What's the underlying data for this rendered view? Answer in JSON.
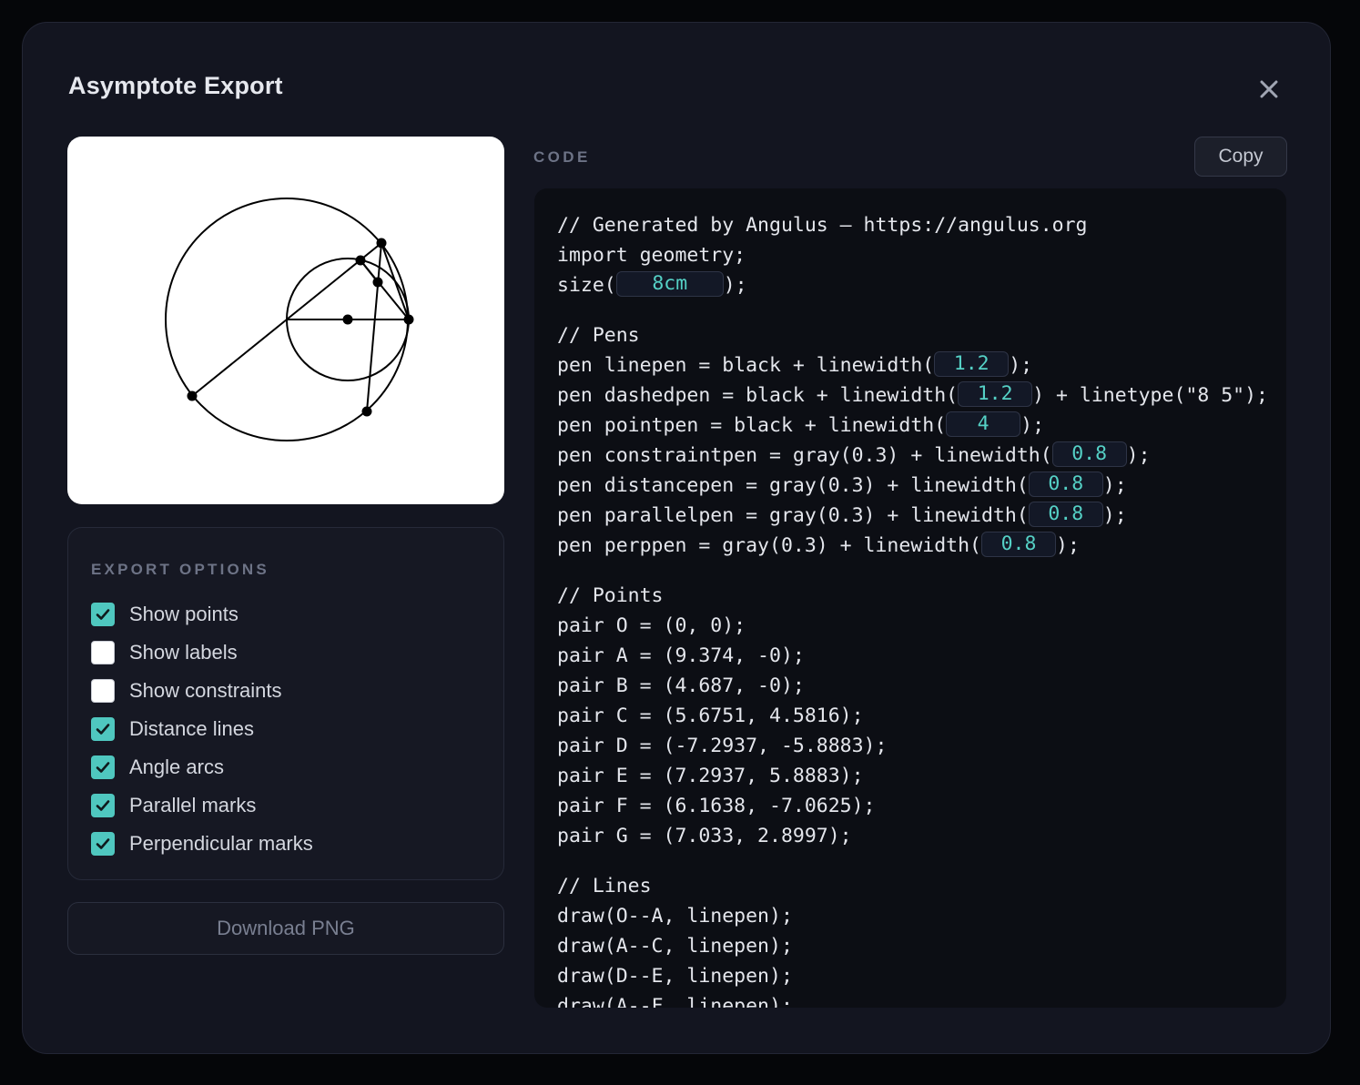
{
  "dialog": {
    "title": "Asymptote Export",
    "close_icon": "close-icon"
  },
  "export_options": {
    "heading": "EXPORT OPTIONS",
    "items": [
      {
        "label": "Show points",
        "checked": true
      },
      {
        "label": "Show labels",
        "checked": false
      },
      {
        "label": "Show constraints",
        "checked": false
      },
      {
        "label": "Distance lines",
        "checked": true
      },
      {
        "label": "Angle arcs",
        "checked": true
      },
      {
        "label": "Parallel marks",
        "checked": true
      },
      {
        "label": "Perpendicular marks",
        "checked": true
      }
    ]
  },
  "download_label": "Download PNG",
  "code_panel": {
    "label": "CODE",
    "copy_label": "Copy",
    "header_lines": [
      "// Generated by Angulus — https://angulus.org",
      "import geometry;"
    ],
    "size": {
      "prefix": "size(",
      "value": "8cm",
      "suffix": ");"
    },
    "pens_comment": "// Pens",
    "pens": [
      {
        "prefix": "pen linepen = black + linewidth(",
        "value": "1.2",
        "suffix": ");"
      },
      {
        "prefix": "pen dashedpen = black + linewidth(",
        "value": "1.2",
        "suffix": ") + linetype(\"8 5\");"
      },
      {
        "prefix": "pen pointpen = black + linewidth(",
        "value": "4",
        "suffix": ");"
      },
      {
        "prefix": "pen constraintpen = gray(0.3) + linewidth(",
        "value": "0.8",
        "suffix": ");"
      },
      {
        "prefix": "pen distancepen = gray(0.3) + linewidth(",
        "value": "0.8",
        "suffix": ");"
      },
      {
        "prefix": "pen parallelpen = gray(0.3) + linewidth(",
        "value": "0.8",
        "suffix": ");"
      },
      {
        "prefix": "pen perppen = gray(0.3) + linewidth(",
        "value": "0.8",
        "suffix": ");"
      }
    ],
    "points_comment": "// Points",
    "points": [
      "pair O = (0, 0);",
      "pair A = (9.374, -0);",
      "pair B = (4.687, -0);",
      "pair C = (5.6751, 4.5816);",
      "pair D = (-7.2937, -5.8883);",
      "pair E = (7.2937, 5.8883);",
      "pair F = (6.1638, -7.0625);",
      "pair G = (7.033, 2.8997);"
    ],
    "lines_comment": "// Lines",
    "lines": [
      "draw(O--A, linepen);",
      "draw(A--C, linepen);",
      "draw(D--E, linepen);",
      "draw(A--F, linepen);"
    ]
  },
  "colors": {
    "accent": "#4fc7bf",
    "numeric_value": "#55d1c6",
    "background": "#131520"
  }
}
